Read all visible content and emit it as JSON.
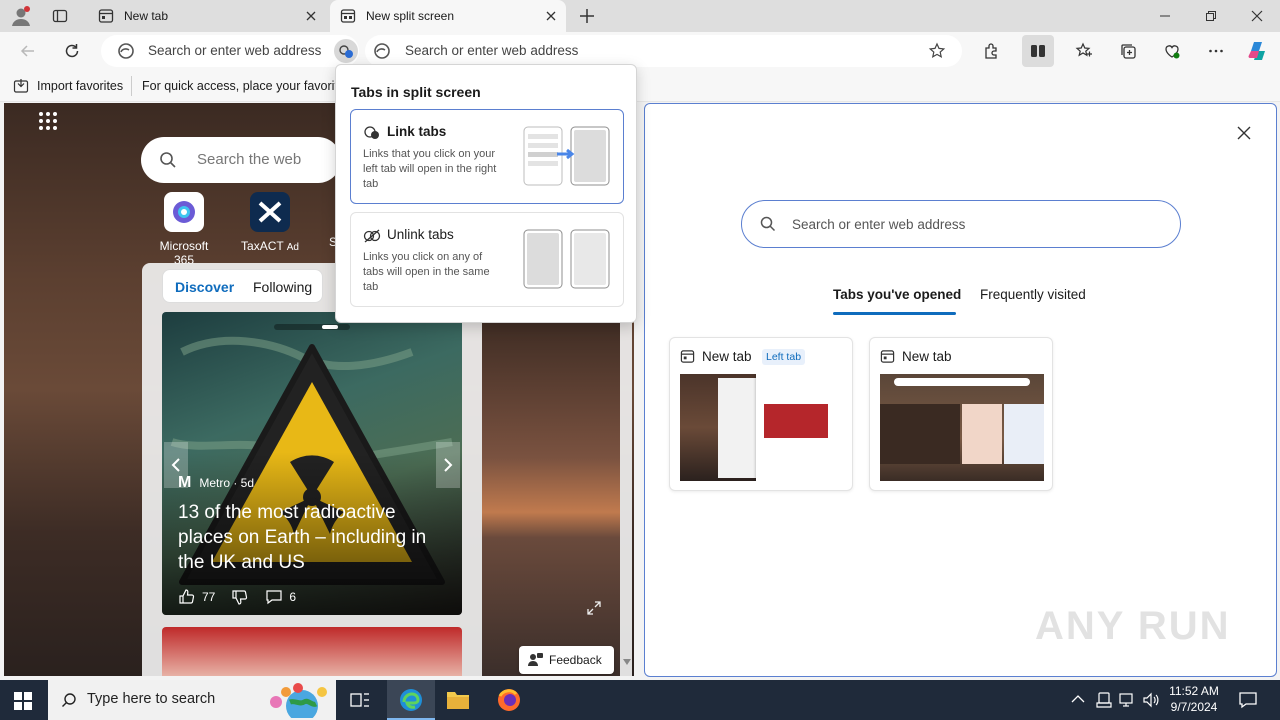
{
  "tabs": [
    {
      "title": "New tab"
    },
    {
      "title": "New split screen"
    }
  ],
  "toolbar": {
    "left_address_placeholder": "Search or enter web address",
    "right_address_placeholder": "Search or enter web address"
  },
  "favorites_bar": {
    "import_label": "Import favorites",
    "hint": "For quick access, place your favorites"
  },
  "left_pane": {
    "search_placeholder": "Search the web",
    "quick_links": [
      {
        "label": "Microsoft 365"
      },
      {
        "label": "TaxACT",
        "ad_label": "Ad"
      },
      {
        "label": "S"
      }
    ],
    "feed_tabs": [
      "Discover",
      "Following"
    ],
    "article": {
      "source": "Metro · 5d",
      "headline": "13 of the most radioactive places on Earth – including in the UK and US",
      "likes": "77",
      "comments": "6"
    },
    "feedback_label": "Feedback"
  },
  "split_popup": {
    "title": "Tabs in split screen",
    "options": [
      {
        "title": "Link tabs",
        "description": "Links that you click on your left tab will open in the right tab"
      },
      {
        "title": "Unlink tabs",
        "description": "Links you click on any of tabs will open in the same tab"
      }
    ]
  },
  "right_pane": {
    "search_placeholder": "Search or enter web address",
    "tabs": [
      "Tabs you've opened",
      "Frequently visited"
    ],
    "cards": [
      {
        "title": "New tab",
        "badge": "Left tab"
      },
      {
        "title": "New tab",
        "badge": ""
      }
    ]
  },
  "taskbar": {
    "search_placeholder": "Type here to search",
    "time": "11:52 AM",
    "date": "9/7/2024"
  },
  "watermark": "ANY RUN",
  "colors": {
    "accent": "#0f6cbd",
    "focus_border": "#5b7fd0",
    "taskbar": "#1f2a3a"
  }
}
